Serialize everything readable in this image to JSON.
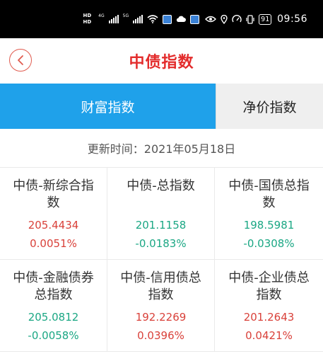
{
  "status_bar": {
    "hd1": "HD",
    "hd2": "HD",
    "net1": "4G",
    "net2": "5G",
    "battery": "91",
    "time": "09:56"
  },
  "header": {
    "title": "中债指数"
  },
  "tabs": [
    {
      "label": "财富指数",
      "active": true
    },
    {
      "label": "净价指数",
      "active": false
    }
  ],
  "update": {
    "label": "更新时间：",
    "date": "2021年05月18日"
  },
  "indices": [
    {
      "name": "中债-新综合指数",
      "value": "205.4434",
      "change": "0.0051%",
      "trend": "up"
    },
    {
      "name": "中债-总指数",
      "value": "201.1158",
      "change": "-0.0183%",
      "trend": "down"
    },
    {
      "name": "中债-国债总指数",
      "value": "198.5981",
      "change": "-0.0308%",
      "trend": "down"
    },
    {
      "name": "中债-金融债券总指数",
      "value": "205.0812",
      "change": "-0.0058%",
      "trend": "down"
    },
    {
      "name": "中债-信用债总指数",
      "value": "192.2269",
      "change": "0.0396%",
      "trend": "up"
    },
    {
      "name": "中债-企业债总指数",
      "value": "201.2643",
      "change": "0.0421%",
      "trend": "up"
    }
  ],
  "colors": {
    "title_red": "#e32c2c",
    "tab_active_blue": "#1fa1ea",
    "up_red": "#d9413a",
    "down_green": "#1ba784"
  }
}
